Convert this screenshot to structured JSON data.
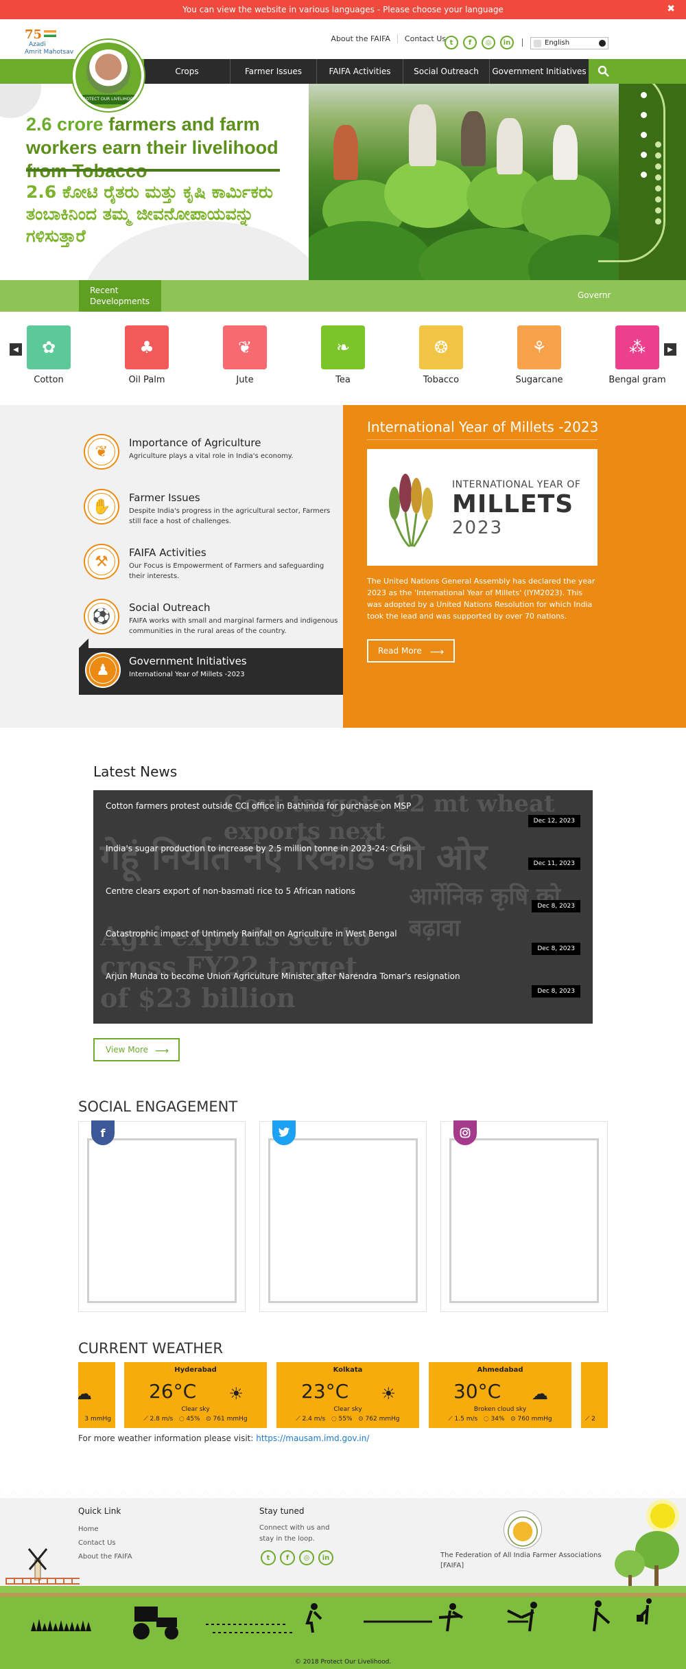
{
  "top_banner": {
    "text": "You can view the website in various languages - ",
    "link": "Please choose your language",
    "close": "✖"
  },
  "azadi_logo": {
    "number": "75",
    "line1": "Azadi",
    "line2": "Amrit Mahotsav"
  },
  "header": {
    "links": [
      "About the FAIFA",
      "Contact Us"
    ],
    "social_icons": [
      "twitter-icon",
      "facebook-icon",
      "instagram-icon",
      "linkedin-icon"
    ],
    "language": "English"
  },
  "logo": {
    "ring_text": "PROTECT OUR LIVELIHOOD"
  },
  "nav": {
    "items": [
      "Crops",
      "Farmer Issues",
      "FAIFA Activities",
      "Social Outreach",
      "Government Initiatives"
    ],
    "search_icon": "search-icon"
  },
  "hero": {
    "en_highlight": "2.6 crore",
    "en_rest": " farmers and farm workers earn their livelihood from Tobacco",
    "kn_highlight": "2.6 ಕೋಟಿ",
    "kn_rest": " ರೈತರು ಮತ್ತು ಕೃಷಿ ಕಾರ್ಮಿಕರು ತಂಬಾಕಿನಿಂದ ತಮ್ಮ ಜೀವನೋಪಾಯವನ್ನು ಗಳಿಸುತ್ತಾರೆ"
  },
  "recent": {
    "label": "Recent Developments",
    "ticker": "Governr"
  },
  "crops": [
    {
      "name": "Cotton",
      "color": "#5cc99a",
      "icon": "✿"
    },
    {
      "name": "Oil Palm",
      "color": "#f25a5a",
      "icon": "♣"
    },
    {
      "name": "Jute",
      "color": "#f76a70",
      "icon": "❦"
    },
    {
      "name": "Tea",
      "color": "#7bc42a",
      "icon": "❧"
    },
    {
      "name": "Tobacco",
      "color": "#f2c443",
      "icon": "❂"
    },
    {
      "name": "Sugarcane",
      "color": "#f7a14a",
      "icon": "⚘"
    },
    {
      "name": "Bengal gram",
      "color": "#ec3f8c",
      "icon": "⁂"
    }
  ],
  "features": [
    {
      "title": "Importance of Agriculture",
      "desc": "Agriculture plays a vital role in India's economy.",
      "icon": "❦"
    },
    {
      "title": "Farmer Issues",
      "desc": "Despite India's progress in the agricultural sector, Farmers still face a host of challenges.",
      "icon": "✋"
    },
    {
      "title": "FAIFA Activities",
      "desc": "Our Focus is Empowerment of Farmers and safeguarding their interests.",
      "icon": "⚒"
    },
    {
      "title": "Social Outreach",
      "desc": "FAIFA works with small and marginal farmers and indigenous communities in the rural areas of the country.",
      "icon": "⚽"
    },
    {
      "title": "Government Initiatives",
      "desc": "International Year of Millets -2023",
      "icon": "♟"
    }
  ],
  "millets": {
    "title": "International Year of Millets -2023",
    "img_line1": "INTERNATIONAL YEAR OF",
    "img_line2": "MILLETS",
    "img_line3": "2023",
    "text": "The United Nations General Assembly has declared the year 2023 as the 'International Year of Millets' (IYM2023). This was adopted by a United Nations Resolution for which India took the lead and was supported by over 70 nations.",
    "button": "Read More"
  },
  "news": {
    "heading": "Latest News",
    "items": [
      {
        "headline": "Cotton farmers protest outside CCI office in Bathinda for purchase on MSP",
        "date": "Dec 12, 2023"
      },
      {
        "headline": "India's sugar production to increase by 2.5 million tonne in 2023-24: Crisil",
        "date": "Dec 11, 2023"
      },
      {
        "headline": "Centre clears export of non-basmati rice to 5 African nations",
        "date": "Dec 8, 2023"
      },
      {
        "headline": "Catastrophic impact of Untimely Rainfall on Agriculture in West Bengal",
        "date": "Dec 8, 2023"
      },
      {
        "headline": "Arjun Munda to become Union Agriculture Minister after Narendra Tomar's resignation",
        "date": "Dec 8, 2023"
      }
    ],
    "bg_texts": [
      "Govt targets 12 mt wheat exports next",
      "गेहूं निर्यात नए रिकार्ड की ओर",
      "Agri exports set to",
      "cross FY22 target",
      "of $23 billion",
      "आर्गेनिक कृषि को बढ़ावा"
    ],
    "view_more": "View More"
  },
  "social": {
    "heading": "SOCIAL ENGAGEMENT",
    "boxes": [
      {
        "icon": "facebook-icon",
        "glyph": "f",
        "color": "#3b5998"
      },
      {
        "icon": "twitter-icon",
        "glyph": "🐦",
        "color": "#1da1f2"
      },
      {
        "icon": "instagram-icon",
        "glyph": "◎",
        "color": "#a53a8c"
      }
    ]
  },
  "weather": {
    "heading": "CURRENT WEATHER",
    "partial_left": {
      "icon": "☁",
      "pressure": "3 mmHg"
    },
    "cards": [
      {
        "city": "Hyderabad",
        "temp": "26°C",
        "icon": "☀",
        "sky": "Clear sky",
        "wind": "2.8 m/s",
        "humidity": "45%",
        "pressure": "761 mmHg"
      },
      {
        "city": "Kolkata",
        "temp": "23°C",
        "icon": "☀",
        "sky": "Clear sky",
        "wind": "2.4 m/s",
        "humidity": "55%",
        "pressure": "762 mmHg"
      },
      {
        "city": "Ahmedabad",
        "temp": "30°C",
        "icon": "☁",
        "sky": "Broken cloud sky",
        "wind": "1.5 m/s",
        "humidity": "34%",
        "pressure": "760 mmHg"
      }
    ],
    "partial_right": {
      "stat": "2"
    },
    "note": "For more weather information please visit: ",
    "note_link": "https://mausam.imd.gov.in/"
  },
  "footer": {
    "quick_link_heading": "Quick Link",
    "quick_links": [
      "Home",
      "Contact Us",
      "About the FAIFA"
    ],
    "stay_heading": "Stay tuned",
    "stay_text": "Connect with us and stay in the loop.",
    "org_name": "The Federation of All India Farmer Associations [FAIFA]",
    "copyright": "© 2018 Protect Our Livelihood."
  }
}
